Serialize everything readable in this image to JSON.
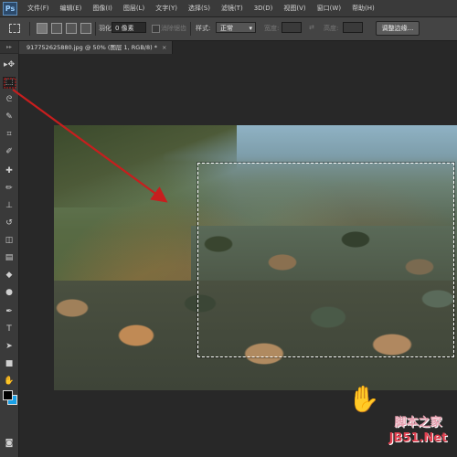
{
  "app": {
    "logo": "Ps"
  },
  "menubar": {
    "items": [
      "文件(F)",
      "编辑(E)",
      "图像(I)",
      "图层(L)",
      "文字(Y)",
      "选择(S)",
      "滤镜(T)",
      "3D(D)",
      "视图(V)",
      "窗口(W)",
      "帮助(H)"
    ]
  },
  "options": {
    "feather_label": "羽化:",
    "feather_value": "0 像素",
    "antialias_label": "消除锯齿",
    "style_label": "样式:",
    "style_value": "正常",
    "width_label": "宽度:",
    "height_label": "高度:",
    "refine_edge_label": "调整边缘..."
  },
  "document": {
    "tab_title": "917752625880.jpg @ 50% (图层 1, RGB/8) *",
    "close_label": "×"
  },
  "tools": {
    "collapse_glyph": "▸▸",
    "items": [
      {
        "icon": "move-icon",
        "glyph": "▸✥"
      },
      {
        "icon": "rect-marquee-icon",
        "glyph": "⬚"
      },
      {
        "icon": "lasso-icon",
        "glyph": "ᘓ"
      },
      {
        "icon": "quick-select-icon",
        "glyph": "✎"
      },
      {
        "icon": "crop-icon",
        "glyph": "⌗"
      },
      {
        "icon": "eyedropper-icon",
        "glyph": "✐"
      },
      {
        "icon": "healing-brush-icon",
        "glyph": "✚"
      },
      {
        "icon": "brush-icon",
        "glyph": "✏"
      },
      {
        "icon": "stamp-icon",
        "glyph": "⊥"
      },
      {
        "icon": "history-brush-icon",
        "glyph": "↺"
      },
      {
        "icon": "eraser-icon",
        "glyph": "◫"
      },
      {
        "icon": "gradient-icon",
        "glyph": "▤"
      },
      {
        "icon": "blur-icon",
        "glyph": "◆"
      },
      {
        "icon": "dodge-icon",
        "glyph": "●"
      },
      {
        "icon": "pen-icon",
        "glyph": "✒"
      },
      {
        "icon": "type-icon",
        "glyph": "T"
      },
      {
        "icon": "path-select-icon",
        "glyph": "➤"
      },
      {
        "icon": "shape-icon",
        "glyph": "■"
      },
      {
        "icon": "hand-icon",
        "glyph": "✋"
      },
      {
        "icon": "zoom-icon",
        "glyph": "⚲"
      }
    ],
    "active_index": 1,
    "foreground_color": "#000000",
    "background_color": "#1aa0e6",
    "quickmask_glyph": "◙"
  },
  "colors": {
    "annotation_arrow": "#c81e1e",
    "selection_marquee": "#ffffff"
  },
  "watermark": {
    "line1": "脚本之家",
    "line2": "JB51.Net"
  }
}
